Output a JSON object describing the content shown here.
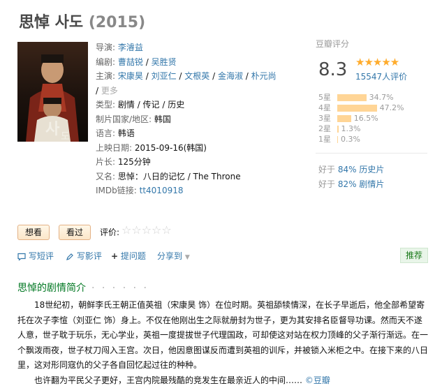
{
  "title": "思悼 사도",
  "year": "(2015)",
  "info": {
    "director_label": "导演:",
    "directors": [
      "李濬益"
    ],
    "writer_label": "编剧:",
    "writers": [
      "曹喆锐",
      "吴胜贤"
    ],
    "cast_label": "主演:",
    "cast": [
      "宋康昊",
      "刘亚仁",
      "文根英",
      "金海淑",
      "朴元尚"
    ],
    "more": "更多",
    "sep": " / ",
    "genre_label": "类型:",
    "genres": "剧情 / 传记 / 历史",
    "country_label": "制片国家/地区:",
    "country": "韩国",
    "language_label": "语言:",
    "language": "韩语",
    "release_label": "上映日期:",
    "release": "2015-09-16(韩国)",
    "runtime_label": "片长:",
    "runtime": "125分钟",
    "aka_label": "又名:",
    "aka": "思悼：八日的记忆 / The Throne",
    "imdb_label": "IMDb链接:",
    "imdb": "tt4010918"
  },
  "rating": {
    "heading": "豆瓣评分",
    "score": "8.3",
    "stars": "★★★★★",
    "votes": "15547人评价",
    "distribution": [
      {
        "label": "5星",
        "percent": 34.7,
        "text": "34.7%"
      },
      {
        "label": "4星",
        "percent": 47.2,
        "text": "47.2%"
      },
      {
        "label": "3星",
        "percent": 16.5,
        "text": "16.5%"
      },
      {
        "label": "2星",
        "percent": 1.3,
        "text": "1.3%"
      },
      {
        "label": "1星",
        "percent": 0.3,
        "text": "0.3%"
      }
    ],
    "better_than": [
      {
        "prefix": "好于 ",
        "link": "84% 历史片"
      },
      {
        "prefix": "好于 ",
        "link": "82% 剧情片"
      }
    ]
  },
  "buttons": {
    "want": "想看",
    "seen": "看过",
    "rate_label": "评价:",
    "rate_stars": "☆☆☆☆☆"
  },
  "actions": {
    "short_review": "写短评",
    "review": "写影评",
    "ask": "提问题",
    "share": "分享到",
    "recommend": "推荐"
  },
  "synopsis": {
    "heading": "思悼的剧情简介",
    "dots": "· · · · · ·",
    "para1": "18世纪初，朝鲜李氏王朝正值英祖（宋康昊 饰）在位时期。英祖舔犊情深，在长子早逝后，他全部希望寄托在次子李愃（刘亚仁 饰）身上。不仅在他刚出生之际就册封为世子，更为其安排名臣督导功课。然而天不遂人意，世子耽于玩乐，无心学业，英祖一度提拔世子代理国政，可却使这对站在权力顶峰的父子渐行渐远。在一个飘泼雨夜，世子杖刀闯入王宫。次日，他因意图谋反而遭到英祖的训斥，并被锁入米柜之中。在接下来的八日里，这对形同寇仇的父子各自回忆起过往的种种。",
    "para2": "也许翻为平民父子更好，王宫内院最残酷的竞发生在最亲近人的中间……",
    "credit": "©豆瓣"
  },
  "colors": {
    "link": "#3377aa",
    "accent_green": "#007722",
    "star": "#ffac2d",
    "bar": "#ffd596"
  }
}
